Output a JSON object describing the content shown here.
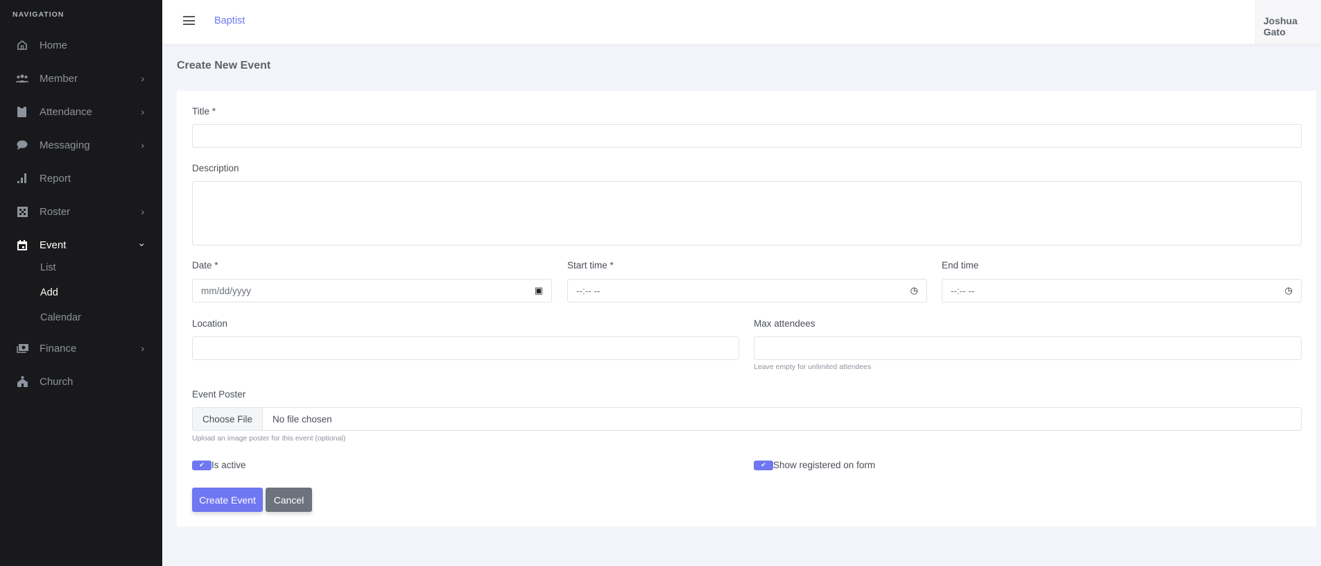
{
  "sidebar": {
    "heading": "NAVIGATION",
    "items": [
      {
        "label": "Home",
        "icon": "home-icon"
      },
      {
        "label": "Member",
        "icon": "users-icon"
      },
      {
        "label": "Attendance",
        "icon": "clipboard-check-icon"
      },
      {
        "label": "Messaging",
        "icon": "chat-bubble-icon"
      },
      {
        "label": "Report",
        "icon": "bar-chart-icon"
      },
      {
        "label": "Roster",
        "icon": "grid-icon"
      },
      {
        "label": "Event",
        "icon": "calendar-icon"
      },
      {
        "label": "Finance",
        "icon": "money-icon"
      },
      {
        "label": "Church",
        "icon": "church-icon"
      }
    ],
    "event_sub": [
      "List",
      "Add",
      "Calendar"
    ]
  },
  "topbar": {
    "brand": "Baptist",
    "user": "Joshua Gato"
  },
  "page": {
    "title": "Create New Event"
  },
  "form": {
    "title_label": "Title *",
    "title_value": "",
    "description_label": "Description",
    "description_value": "",
    "date_label": "Date *",
    "date_placeholder": "mm/dd/yyyy",
    "start_label": "Start time *",
    "start_placeholder": "--:-- --",
    "end_label": "End time",
    "end_placeholder": "--:-- --",
    "location_label": "Location",
    "location_value": "",
    "max_label": "Max attendees",
    "max_value": "",
    "max_help": "Leave empty for unlimited attendees",
    "poster_label": "Event Poster",
    "choose_file": "Choose File",
    "no_file": "No file chosen",
    "poster_help": "Upload an image poster for this event (optional)",
    "is_active_label": "Is active",
    "is_active": true,
    "show_registered_label": "Show registered on form",
    "show_registered": true,
    "submit": "Create Event",
    "cancel": "Cancel"
  },
  "colors": {
    "accent": "#6f77f2",
    "sidebar": "#19191b",
    "cancel": "#6c737c"
  }
}
